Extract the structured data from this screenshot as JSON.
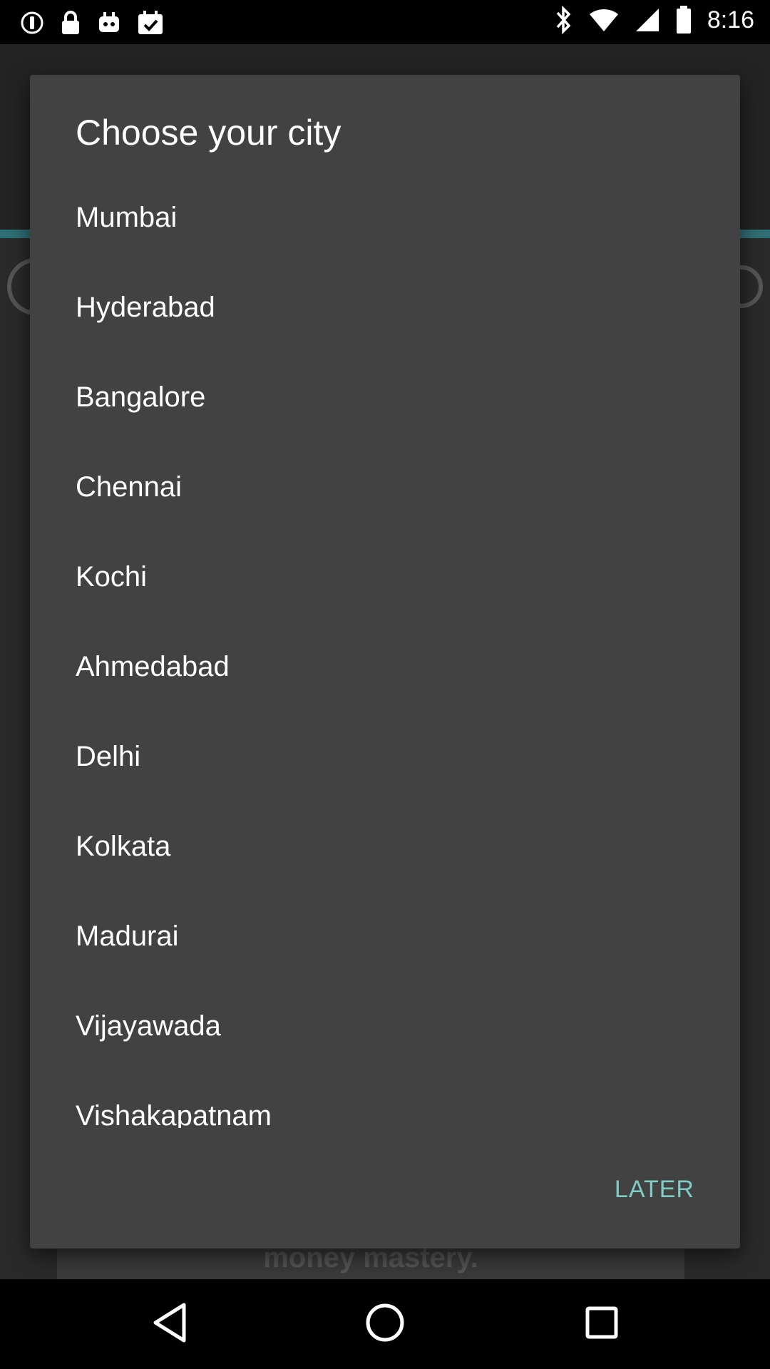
{
  "status_bar": {
    "time": "8:16",
    "left_icons": [
      "circle-info-icon",
      "lock-icon",
      "robot-icon",
      "calendar-check-icon"
    ],
    "right_icons": [
      "bluetooth-icon",
      "wifi-icon",
      "signal-icon",
      "battery-icon"
    ]
  },
  "dialog": {
    "title": "Choose your city",
    "cities": [
      "Mumbai",
      "Hyderabad",
      "Bangalore",
      "Chennai",
      "Kochi",
      "Ahmedabad",
      "Delhi",
      "Kolkata",
      "Madurai",
      "Vijayawada",
      "Vishakapatnam"
    ],
    "later_label": "LATER",
    "accent_color": "#80cbc4",
    "background_color": "#424242"
  },
  "background": {
    "banner_text": "money mastery."
  },
  "nav_bar": {
    "icons": [
      "back-icon",
      "home-icon",
      "recent-apps-icon"
    ]
  }
}
